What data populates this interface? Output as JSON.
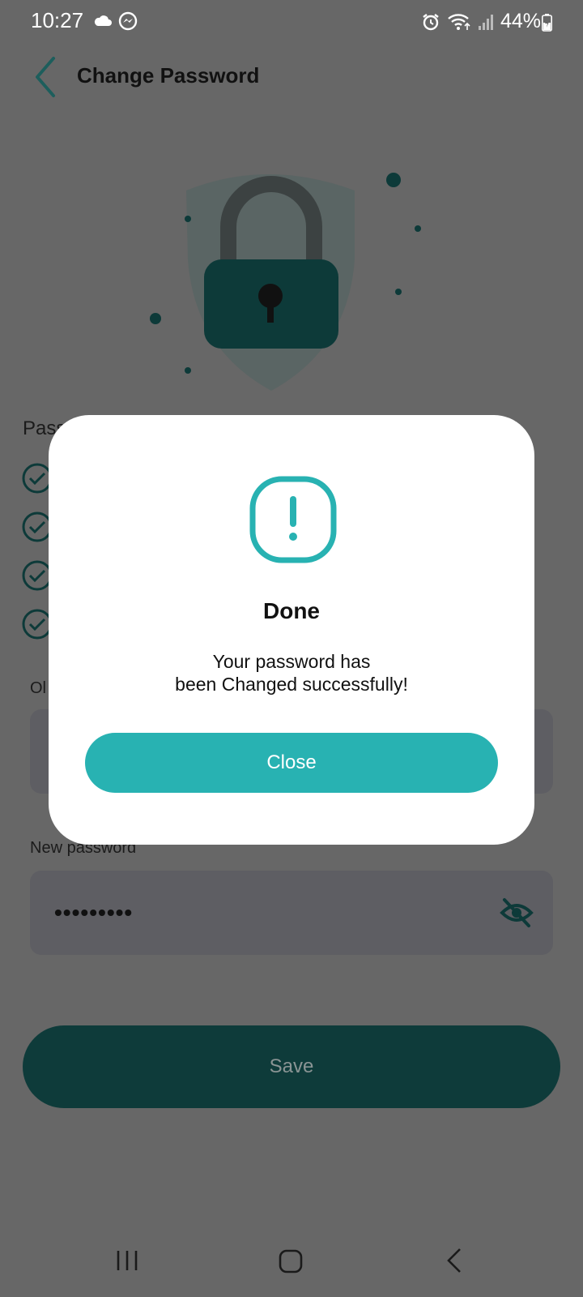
{
  "status_bar": {
    "time": "10:27",
    "battery": "44%"
  },
  "header": {
    "title": "Change Password"
  },
  "background": {
    "section_label_partial": "Pass",
    "old_password_label_partial": "Ol",
    "new_password_label": "New password",
    "new_password_value": "•••••••••",
    "save_label": "Save"
  },
  "dialog": {
    "title": "Done",
    "message_line1": "Your password has",
    "message_line2": "been Changed successfully!",
    "close_label": "Close"
  },
  "colors": {
    "accent": "#28b2b2",
    "dark_teal": "#0e3b3a",
    "overlay": "#676767"
  },
  "icons": [
    "back-arrow-icon",
    "cloud-icon",
    "messenger-icon",
    "alarm-icon",
    "wifi-icon",
    "signal-icon",
    "battery-icon",
    "lock-shield-icon",
    "check-circle-icon",
    "eye-off-icon",
    "alert-icon",
    "recents-icon",
    "home-icon",
    "nav-back-icon"
  ]
}
